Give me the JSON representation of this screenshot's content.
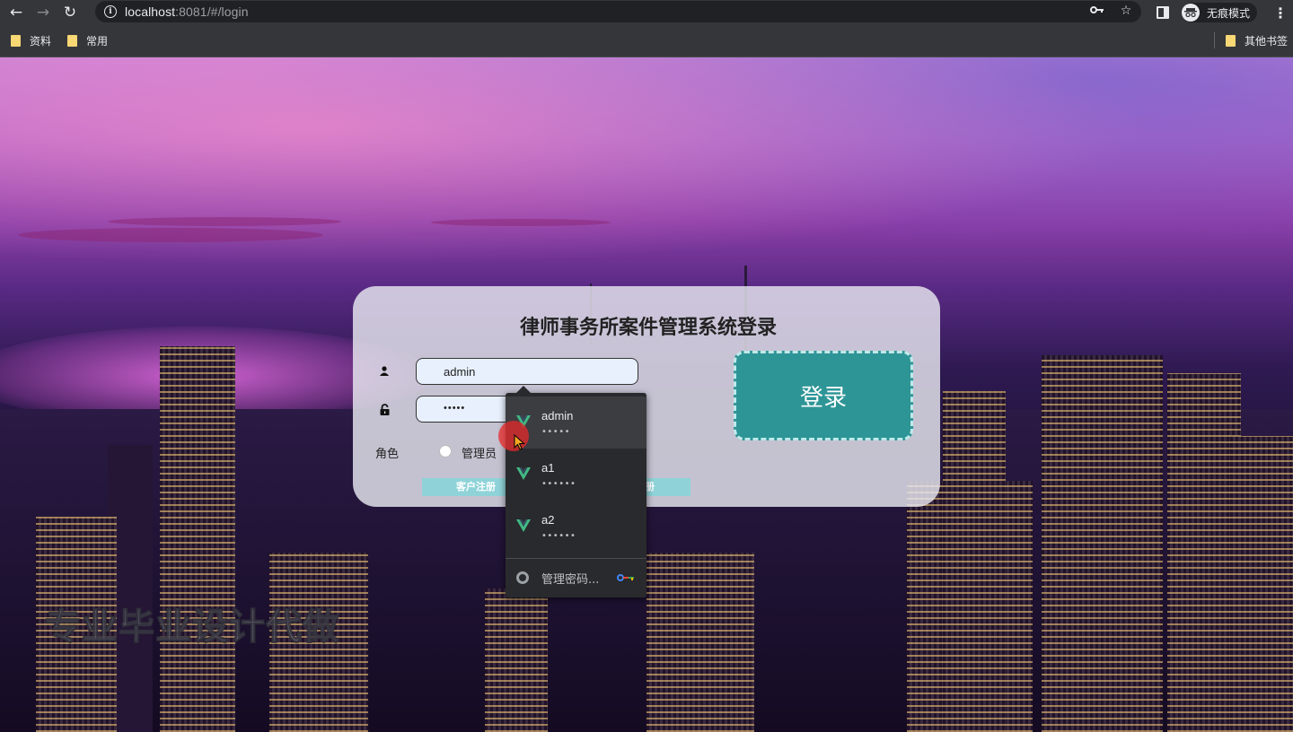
{
  "browser": {
    "url_host": "localhost",
    "url_rest": ":8081/#/login",
    "incognito_label": "无痕模式",
    "bookmarks": [
      "资料",
      "常用"
    ],
    "other_bookmarks": "其他书签"
  },
  "login": {
    "title": "律师事务所案件管理系统登录",
    "username_value": "admin",
    "password_value": "•••••",
    "role_label": "角色",
    "role_option": "管理员",
    "register_customer": "客户注册",
    "register_other_partial": "册",
    "login_button": "登录"
  },
  "autofill": {
    "items": [
      {
        "user": "admin",
        "pass": "•••••"
      },
      {
        "user": "a1",
        "pass": "••••••"
      },
      {
        "user": "a2",
        "pass": "••••••"
      }
    ],
    "manage_label": "管理密码..."
  },
  "watermark": "专业毕业设计代做",
  "colors": {
    "accent": "#2e9597",
    "register_bg": "#8fd3d8",
    "vue_green": "#41b883"
  }
}
